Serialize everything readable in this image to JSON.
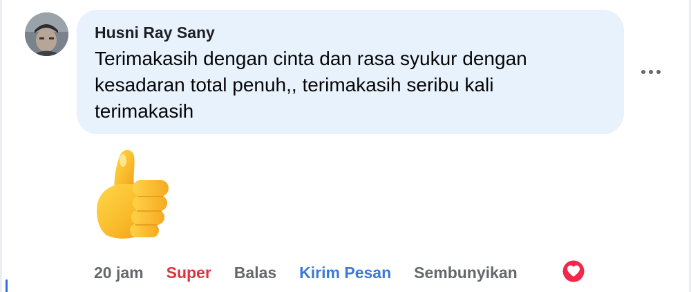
{
  "comment": {
    "author": "Husni Ray Sany",
    "text": "Terimakasih dengan cinta dan rasa syukur dengan kesadaran total penuh,, terimakasih seribu kali terimakasih",
    "avatar_icon": "user-photo-avatar",
    "more_icon": "more-horizontal-icon",
    "sticker_icon": "thumbs-up-sticker"
  },
  "actions": {
    "time": "20 jam",
    "reaction": "Super",
    "reply": "Balas",
    "message": "Kirim Pesan",
    "hide": "Sembunyikan",
    "reaction_icon": "heart-reaction-icon"
  },
  "colors": {
    "bubble": "#e8f2fd",
    "super": "#d8353d",
    "link": "#3b78d8",
    "muted": "#65676b",
    "heart": "#f0284a"
  }
}
